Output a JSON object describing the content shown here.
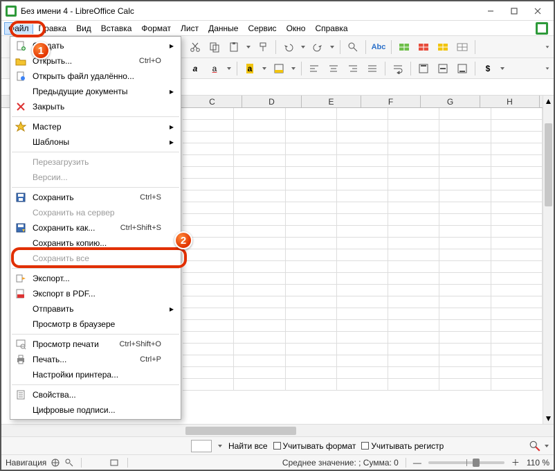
{
  "window": {
    "title": "Без имени 4 - LibreOffice Calc"
  },
  "menubar": {
    "items": [
      "Файл",
      "Правка",
      "Вид",
      "Вставка",
      "Формат",
      "Лист",
      "Данные",
      "Сервис",
      "Окно",
      "Справка"
    ],
    "active_index": 0
  },
  "columns": [
    "C",
    "D",
    "E",
    "F",
    "G",
    "H"
  ],
  "file_menu": {
    "groups": [
      [
        {
          "icon": "doc-new",
          "label": "Создать",
          "shortcut": "",
          "submenu": true,
          "disabled": false
        },
        {
          "icon": "folder-open",
          "label": "Открыть...",
          "shortcut": "Ctrl+O",
          "submenu": false,
          "disabled": false
        },
        {
          "icon": "doc-remote",
          "label": "Открыть файл удалённо...",
          "shortcut": "",
          "submenu": false,
          "disabled": false
        },
        {
          "icon": "",
          "label": "Предыдущие документы",
          "shortcut": "",
          "submenu": true,
          "disabled": false
        },
        {
          "icon": "close-x",
          "label": "Закрыть",
          "shortcut": "",
          "submenu": false,
          "disabled": false
        }
      ],
      [
        {
          "icon": "wizard",
          "label": "Мастер",
          "shortcut": "",
          "submenu": true,
          "disabled": false
        },
        {
          "icon": "",
          "label": "Шаблоны",
          "shortcut": "",
          "submenu": true,
          "disabled": false
        }
      ],
      [
        {
          "icon": "",
          "label": "Перезагрузить",
          "shortcut": "",
          "submenu": false,
          "disabled": true
        },
        {
          "icon": "",
          "label": "Версии...",
          "shortcut": "",
          "submenu": false,
          "disabled": true
        }
      ],
      [
        {
          "icon": "save",
          "label": "Сохранить",
          "shortcut": "Ctrl+S",
          "submenu": false,
          "disabled": false
        },
        {
          "icon": "",
          "label": "Сохранить на сервер",
          "shortcut": "",
          "submenu": false,
          "disabled": true
        },
        {
          "icon": "save-as",
          "label": "Сохранить как...",
          "shortcut": "Ctrl+Shift+S",
          "submenu": false,
          "disabled": false,
          "highlight": true
        },
        {
          "icon": "",
          "label": "Сохранить копию...",
          "shortcut": "",
          "submenu": false,
          "disabled": false
        },
        {
          "icon": "",
          "label": "Сохранить все",
          "shortcut": "",
          "submenu": false,
          "disabled": true
        }
      ],
      [
        {
          "icon": "export",
          "label": "Экспорт...",
          "shortcut": "",
          "submenu": false,
          "disabled": false
        },
        {
          "icon": "pdf",
          "label": "Экспорт в PDF...",
          "shortcut": "",
          "submenu": false,
          "disabled": false
        },
        {
          "icon": "",
          "label": "Отправить",
          "shortcut": "",
          "submenu": true,
          "disabled": false
        },
        {
          "icon": "",
          "label": "Просмотр в браузере",
          "shortcut": "",
          "submenu": false,
          "disabled": false
        }
      ],
      [
        {
          "icon": "print-preview",
          "label": "Просмотр печати",
          "shortcut": "Ctrl+Shift+O",
          "submenu": false,
          "disabled": false
        },
        {
          "icon": "print",
          "label": "Печать...",
          "shortcut": "Ctrl+P",
          "submenu": false,
          "disabled": false
        },
        {
          "icon": "",
          "label": "Настройки принтера...",
          "shortcut": "",
          "submenu": false,
          "disabled": false
        }
      ],
      [
        {
          "icon": "properties",
          "label": "Свойства...",
          "shortcut": "",
          "submenu": false,
          "disabled": false
        },
        {
          "icon": "",
          "label": "Цифровые подписи...",
          "shortcut": "",
          "submenu": false,
          "disabled": false
        }
      ]
    ]
  },
  "findbar": {
    "find_all": "Найти все",
    "match_format": "Учитывать формат",
    "match_case": "Учитывать регистр"
  },
  "statusbar": {
    "navigation": "Навигация",
    "summary": "Среднее значение: ; Сумма: 0",
    "zoom": "110 %"
  },
  "callouts": {
    "1": "1",
    "2": "2"
  }
}
